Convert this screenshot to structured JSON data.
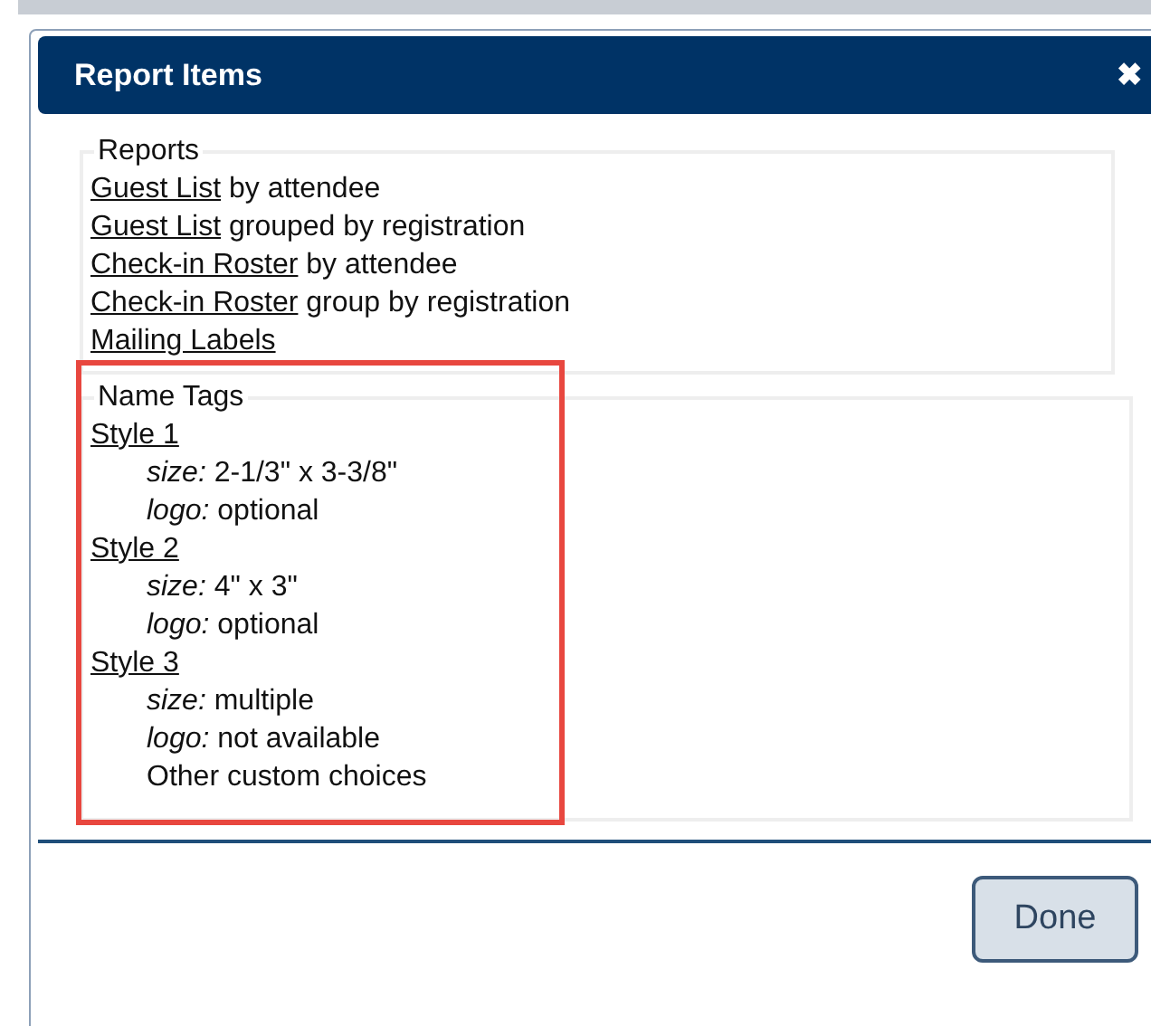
{
  "dialog": {
    "title": "Report Items",
    "close": "✖"
  },
  "reports": {
    "legend": "Reports",
    "items": [
      {
        "link": "Guest List",
        "text": "by attendee"
      },
      {
        "link": "Guest List",
        "text": "grouped by registration"
      },
      {
        "link": "Check-in Roster",
        "text": "by attendee"
      },
      {
        "link": "Check-in Roster",
        "text": "group by registration"
      },
      {
        "link": "Mailing Labels"
      }
    ]
  },
  "name_tags": {
    "legend": "Name Tags",
    "highlighted": true,
    "styles": [
      {
        "link": "Style 1",
        "details": [
          "*size:* 2-1/3\" x 3-3/8\"",
          "*logo:* optional"
        ]
      },
      {
        "link": "Style 2",
        "details": [
          "*size:* 4\" x 3\"",
          "*logo:* optional"
        ]
      },
      {
        "link": "Style 3",
        "details": [
          "*size:* multiple",
          "*logo:* not available",
          "Other custom choices"
        ]
      }
    ]
  },
  "buttons": [
    "Done"
  ]
}
